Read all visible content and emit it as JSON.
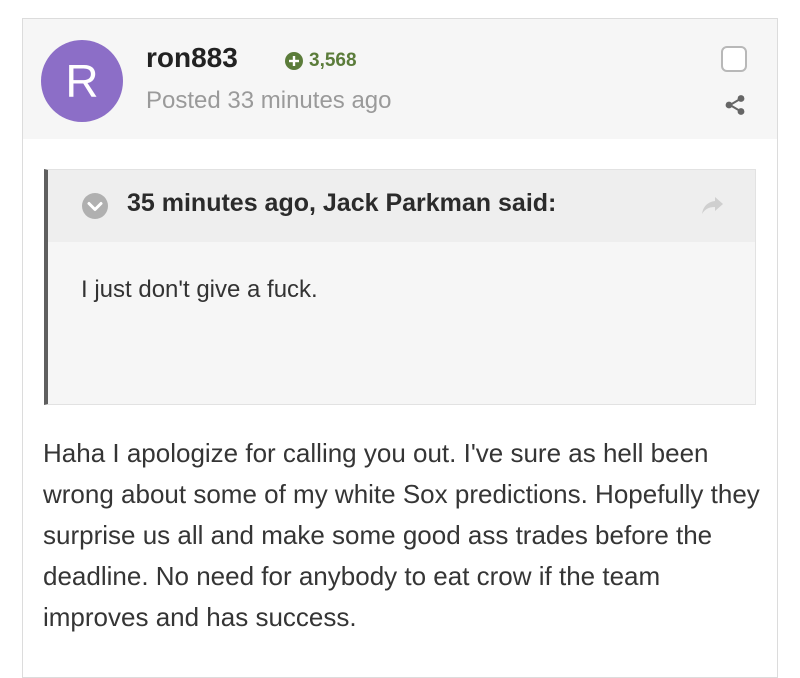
{
  "author": {
    "avatar_letter": "R",
    "avatar_color": "#8c6ec7",
    "username": "ron883",
    "reputation": "3,568",
    "reputation_color": "#5b7c3a",
    "posted": "Posted 33 minutes ago"
  },
  "quote": {
    "citation": "35 minutes ago, Jack Parkman said:",
    "text": "I just don't give a fuck."
  },
  "body": {
    "text": "Haha I apologize for calling you out. I've sure as hell been wrong about some of my white Sox predictions. Hopefully they surprise us all and make some good ass trades before the deadline. No need for anybody to eat crow if the team improves and has success."
  },
  "icons": {
    "reputation": "plus-circle-icon",
    "share": "share-icon",
    "quote_toggle": "chevron-down-icon",
    "quote_jump": "forward-arrow-icon"
  }
}
